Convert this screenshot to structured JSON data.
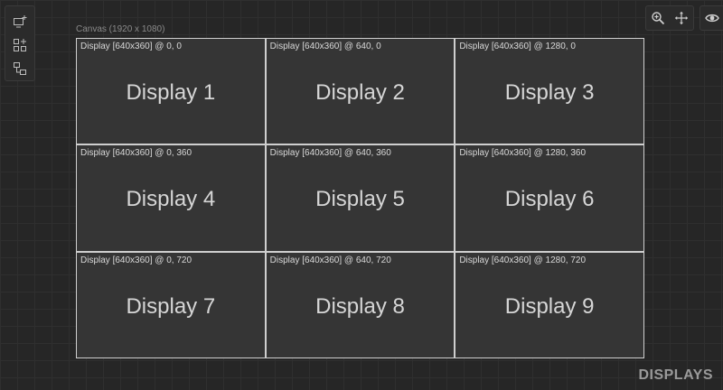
{
  "canvas": {
    "label": "Canvas (1920 x 1080)"
  },
  "left_toolbar": {
    "tools": [
      {
        "name": "add-display-icon"
      },
      {
        "name": "add-display-grid-icon"
      },
      {
        "name": "add-display-group-icon"
      }
    ]
  },
  "right_toolbar": {
    "zoom": "zoom-in-icon",
    "pan": "move-icon",
    "visibility": "eye-icon"
  },
  "displays": [
    {
      "meta": "Display [640x360] @ 0, 0",
      "name": "Display 1"
    },
    {
      "meta": "Display [640x360] @ 640, 0",
      "name": "Display 2"
    },
    {
      "meta": "Display [640x360] @ 1280, 0",
      "name": "Display 3"
    },
    {
      "meta": "Display [640x360] @ 0, 360",
      "name": "Display 4"
    },
    {
      "meta": "Display [640x360] @ 640, 360",
      "name": "Display 5"
    },
    {
      "meta": "Display [640x360] @ 1280, 360",
      "name": "Display 6"
    },
    {
      "meta": "Display [640x360] @ 0, 720",
      "name": "Display 7"
    },
    {
      "meta": "Display [640x360] @ 640, 720",
      "name": "Display 8"
    },
    {
      "meta": "Display [640x360] @ 1280, 720",
      "name": "Display 9"
    }
  ],
  "mode_label": "DISPLAYS",
  "colors": {
    "background": "#262626",
    "display_fill": "#353535",
    "display_border": "#cfcfcf"
  }
}
